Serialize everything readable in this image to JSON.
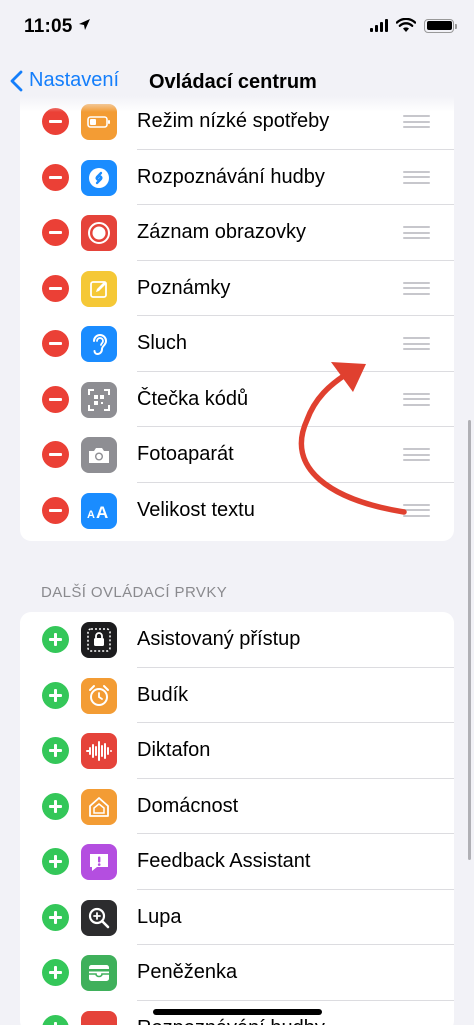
{
  "status_bar": {
    "time": "11:05"
  },
  "nav": {
    "back_label": "Nastavení",
    "title": "Ovládací centrum"
  },
  "included": [
    {
      "label": "Režim nízké spotřeby",
      "icon": "battery-icon",
      "color": "#f39c34"
    },
    {
      "label": "Rozpoznávání hudby",
      "icon": "shazam-icon",
      "color": "#1a8cff"
    },
    {
      "label": "Záznam obrazovky",
      "icon": "screen-record-icon",
      "color": "#e5433a"
    },
    {
      "label": "Poznámky",
      "icon": "notes-icon",
      "color": "#f5c836"
    },
    {
      "label": "Sluch",
      "icon": "ear-icon",
      "color": "#1a8cff"
    },
    {
      "label": "Čtečka kódů",
      "icon": "qr-code-icon",
      "color": "#8e8e93"
    },
    {
      "label": "Fotoaparát",
      "icon": "camera-icon",
      "color": "#8e8e93"
    },
    {
      "label": "Velikost textu",
      "icon": "text-size-icon",
      "color": "#1a8cff"
    }
  ],
  "more_section": {
    "header": "DALŠÍ OVLÁDACÍ PRVKY",
    "items": [
      {
        "label": "Asistovaný přístup",
        "icon": "guided-access-icon",
        "color": "#1c1c1e"
      },
      {
        "label": "Budík",
        "icon": "alarm-icon",
        "color": "#f39c34"
      },
      {
        "label": "Diktafon",
        "icon": "voice-memos-icon",
        "color": "#e5433a"
      },
      {
        "label": "Domácnost",
        "icon": "home-icon",
        "color": "#f39c34"
      },
      {
        "label": "Feedback Assistant",
        "icon": "feedback-icon",
        "color": "#b44ee0"
      },
      {
        "label": "Lupa",
        "icon": "magnifier-icon",
        "color": "#2c2c2e"
      },
      {
        "label": "Peněženka",
        "icon": "wallet-icon",
        "color": "#3fb05b"
      },
      {
        "label": "Rozpoznávání hudby",
        "icon": "partial-icon",
        "color": "#e5433a"
      }
    ]
  },
  "colors": {
    "accent": "#147efb",
    "remove": "#eb4036",
    "add": "#34c759",
    "annotation": "#e0402f"
  }
}
